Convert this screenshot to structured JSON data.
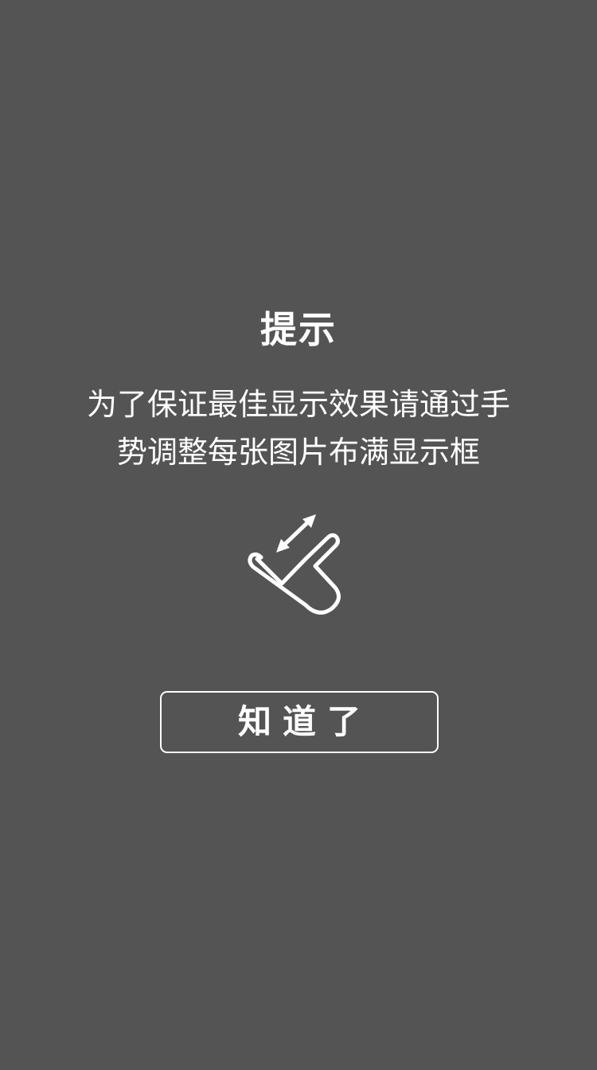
{
  "hint": {
    "title": "提示",
    "message": "为了保证最佳显示效果请通过手势调整每张图片布满显示框",
    "gesture_icon": "pinch-resize-hand-icon",
    "button_label": "知道了"
  },
  "colors": {
    "background": "#545454",
    "foreground": "#ffffff"
  }
}
